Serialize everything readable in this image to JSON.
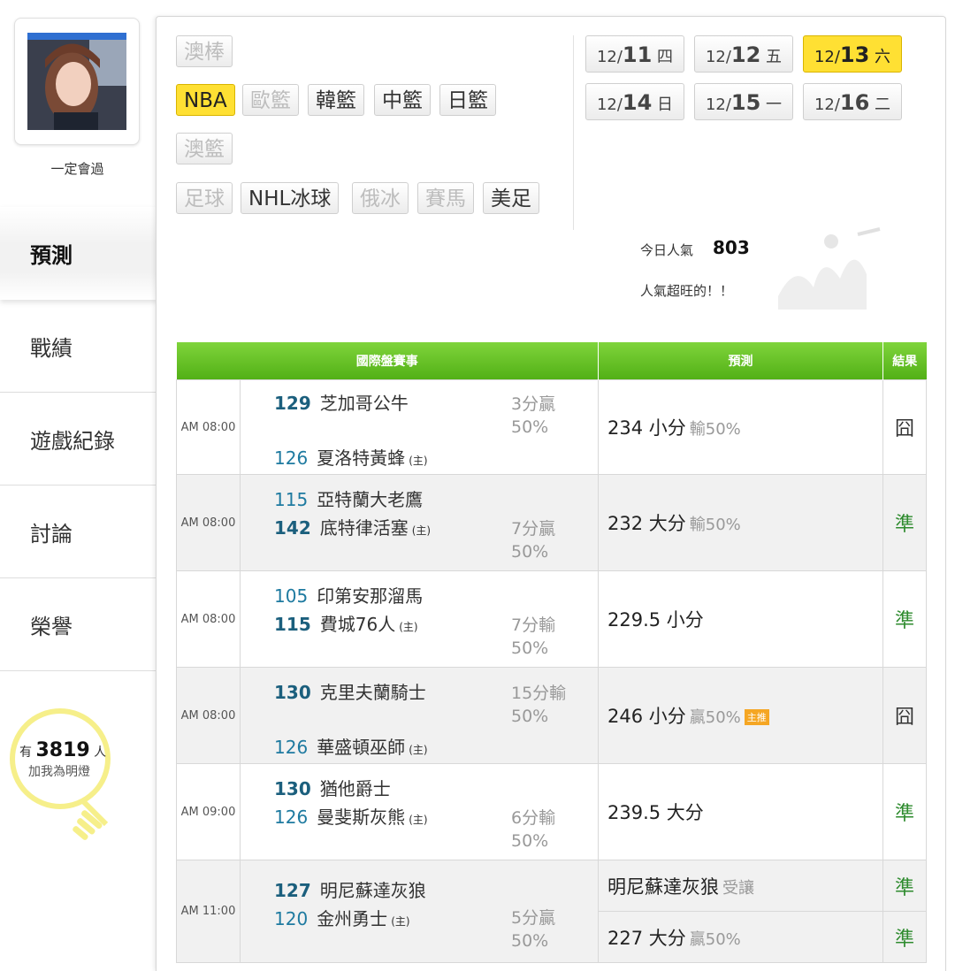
{
  "user": {
    "name": "一定會過"
  },
  "nav": {
    "items": [
      "預測",
      "戰績",
      "遊戲紀錄",
      "討論",
      "榮譽"
    ]
  },
  "fans": {
    "prefix": "有",
    "count": "3819",
    "suffix": "人",
    "line2": "加我為明燈"
  },
  "sports": [
    {
      "label": "澳棒",
      "state": "dim"
    },
    {
      "label": "NBA",
      "state": "active"
    },
    {
      "label": "歐籃",
      "state": "dim"
    },
    {
      "label": "韓籃",
      "state": "normal"
    },
    {
      "label": "中籃",
      "state": "normal"
    },
    {
      "label": "日籃",
      "state": "normal"
    },
    {
      "label": "澳籃",
      "state": "dim"
    },
    {
      "label": "足球",
      "state": "dim"
    },
    {
      "label": "NHL冰球",
      "state": "normal"
    },
    {
      "label": "俄冰",
      "state": "dim"
    },
    {
      "label": "賽馬",
      "state": "dim"
    },
    {
      "label": "美足",
      "state": "normal"
    }
  ],
  "dates": [
    {
      "md": "12/",
      "day": "11",
      "wd": "四"
    },
    {
      "md": "12/",
      "day": "12",
      "wd": "五"
    },
    {
      "md": "12/",
      "day": "13",
      "wd": "六"
    },
    {
      "md": "12/",
      "day": "14",
      "wd": "日"
    },
    {
      "md": "12/",
      "day": "15",
      "wd": "一"
    },
    {
      "md": "12/",
      "day": "16",
      "wd": "二"
    }
  ],
  "popularity": {
    "label": "今日人氣",
    "value": "803",
    "note": "人氣超旺的！！"
  },
  "table": {
    "headers": {
      "event": "國際盤賽事",
      "prediction": "預測",
      "result": "結果"
    },
    "games": [
      {
        "time": "AM 08:00",
        "t1num": "129",
        "t1": "芝加哥公牛",
        "t2num": "126",
        "t2": "夏洛特黃蜂",
        "home": "(主)",
        "h1": "3分贏",
        "h2": "50%",
        "pred": "234 小分",
        "predsub": "輸50%",
        "result": "囧"
      },
      {
        "time": "AM 08:00",
        "t1num": "115",
        "t1": "亞特蘭大老鷹",
        "t2num": "142",
        "t2": "底特律活塞",
        "home": "(主)",
        "h1": "7分贏",
        "h2": "50%",
        "pred": "232 大分",
        "predsub": "輸50%",
        "result": "準"
      },
      {
        "time": "AM 08:00",
        "t1num": "105",
        "t1": "印第安那溜馬",
        "t2num": "115",
        "t2": "費城76人",
        "home": "(主)",
        "h1": "7分輸",
        "h2": "50%",
        "pred": "229.5 小分",
        "predsub": "",
        "result": "準"
      },
      {
        "time": "AM 08:00",
        "t1num": "130",
        "t1": "克里夫蘭騎士",
        "t2num": "126",
        "t2": "華盛頓巫師",
        "home": "(主)",
        "h1": "15分輸",
        "h2": "50%",
        "pred": "246 小分",
        "predsub": "贏50%",
        "badge": "主推",
        "result": "囧"
      },
      {
        "time": "AM 09:00",
        "t1num": "130",
        "t1": "猶他爵士",
        "t2num": "126",
        "t2": "曼斐斯灰熊",
        "home": "(主)",
        "h1": "6分輸",
        "h2": "50%",
        "pred": "239.5 大分",
        "predsub": "",
        "result": "準"
      },
      {
        "time": "AM 11:00",
        "t1num": "127",
        "t1": "明尼蘇達灰狼",
        "t2num": "120",
        "t2": "金州勇士",
        "home": "(主)",
        "h1": "5分贏",
        "h2": "50%",
        "pred": "明尼蘇達灰狼",
        "predsub": "受讓",
        "result": "準",
        "pred2": "227 大分",
        "pred2sub": "贏50%",
        "result2": "準"
      }
    ]
  }
}
